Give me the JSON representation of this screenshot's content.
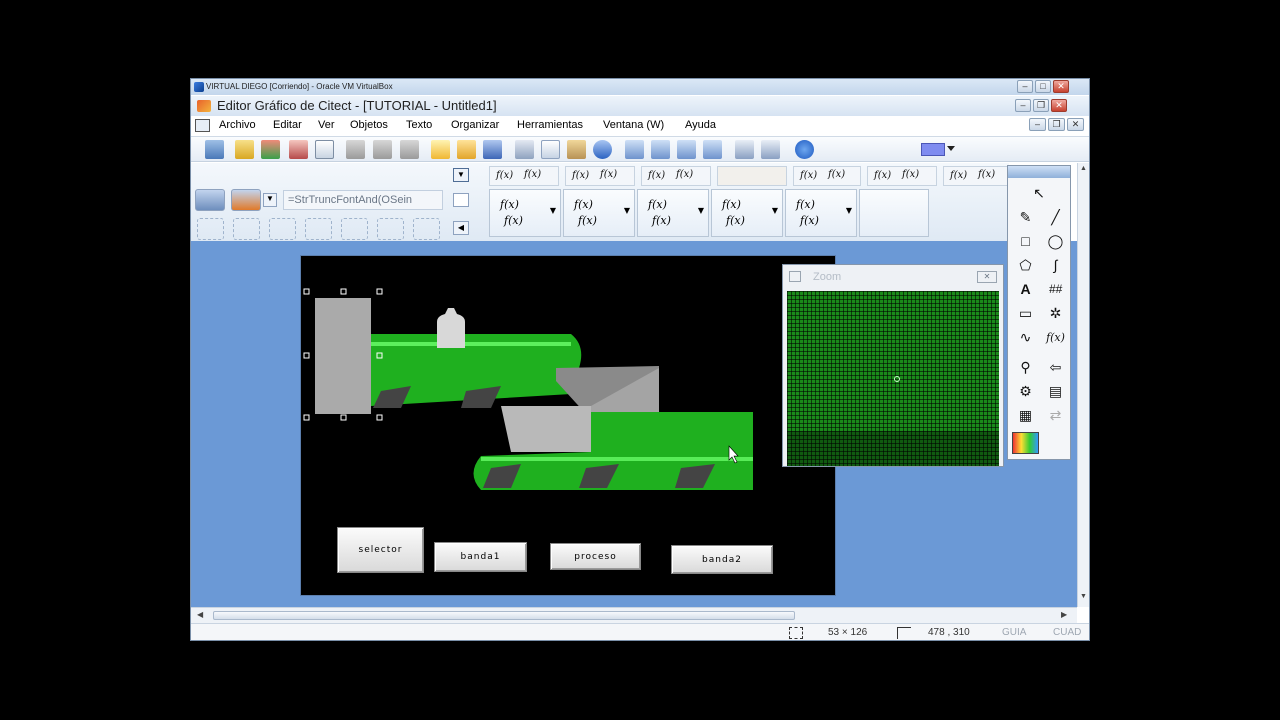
{
  "vbox": {
    "title": "VIRTUAL DIEGO [Corriendo] - Oracle VM VirtualBox"
  },
  "app": {
    "title": "Editor Gráfico de Citect - [TUTORIAL - Untitled1]"
  },
  "menu": [
    "Archivo",
    "Editar",
    "Ver",
    "Objetos",
    "Texto",
    "Organizar",
    "Herramientas",
    "Ventana (W)",
    "Ayuda"
  ],
  "toolbar2": {
    "expression_field": "=StrTruncFontAnd(OSein",
    "fx_small": "f(x)",
    "fx_large": "f(x)"
  },
  "canvas": {
    "buttons": {
      "selector": "selector",
      "banda1": "banda1",
      "proceso": "proceso",
      "banda2": "banda2"
    }
  },
  "zoom": {
    "title": "Zoom"
  },
  "palette": {
    "text_tool": "A",
    "number_tool": "##",
    "fx_tool": "f(x)"
  },
  "status": {
    "size": "53 × 126",
    "position": "478 , 310",
    "guia": "GUIA",
    "cuad": "CUAD"
  },
  "colors": {
    "workspace": "#6b99d6",
    "canvas": "#000000",
    "belt_green": "#22c522",
    "fill_color_swatch": "#7f8cf0"
  }
}
